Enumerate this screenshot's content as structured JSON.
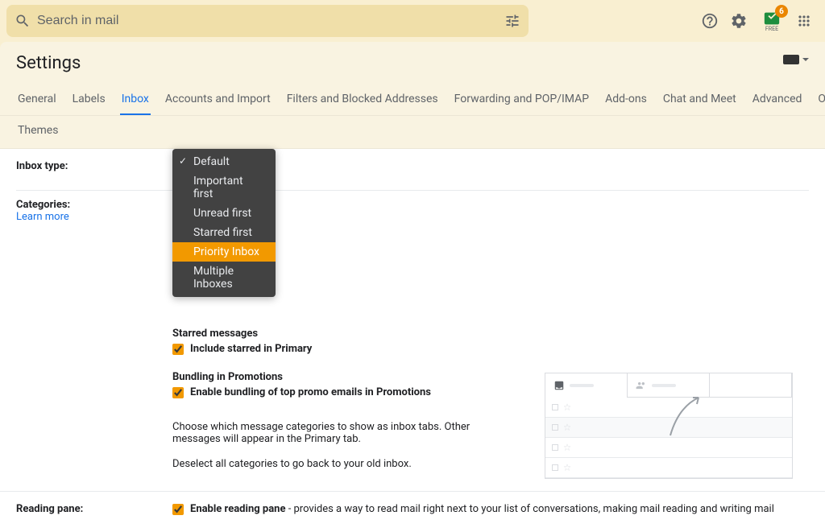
{
  "search": {
    "placeholder": "Search in mail"
  },
  "header": {
    "badge_count": "6",
    "badge_label": "FREE"
  },
  "settings": {
    "title": "Settings"
  },
  "tabs": {
    "row1": [
      "General",
      "Labels",
      "Inbox",
      "Accounts and Import",
      "Filters and Blocked Addresses",
      "Forwarding and POP/IMAP",
      "Add-ons",
      "Chat and Meet",
      "Advanced",
      "Offline"
    ],
    "row2": [
      "Themes"
    ],
    "active": "Inbox"
  },
  "inbox_type": {
    "label": "Inbox type:",
    "options": [
      "Default",
      "Important first",
      "Unread first",
      "Starred first",
      "Priority Inbox",
      "Multiple Inboxes"
    ],
    "checked": "Default",
    "highlighted": "Priority Inbox"
  },
  "categories": {
    "label": "Categories:",
    "link": "Learn more",
    "starred_title": "Starred messages",
    "starred_checkbox": "Include starred in Primary",
    "bundling_title": "Bundling in Promotions",
    "bundling_checkbox": "Enable bundling of top promo emails in Promotions",
    "desc1": "Choose which message categories to show as inbox tabs. Other messages will appear in the Primary tab.",
    "desc2": "Deselect all categories to go back to your old inbox."
  },
  "reading_pane": {
    "label": "Reading pane:",
    "checkbox_bold": "Enable reading pane",
    "checkbox_rest": " - provides a way to read mail right next to your list of conversations, making mail reading and writing mail"
  }
}
